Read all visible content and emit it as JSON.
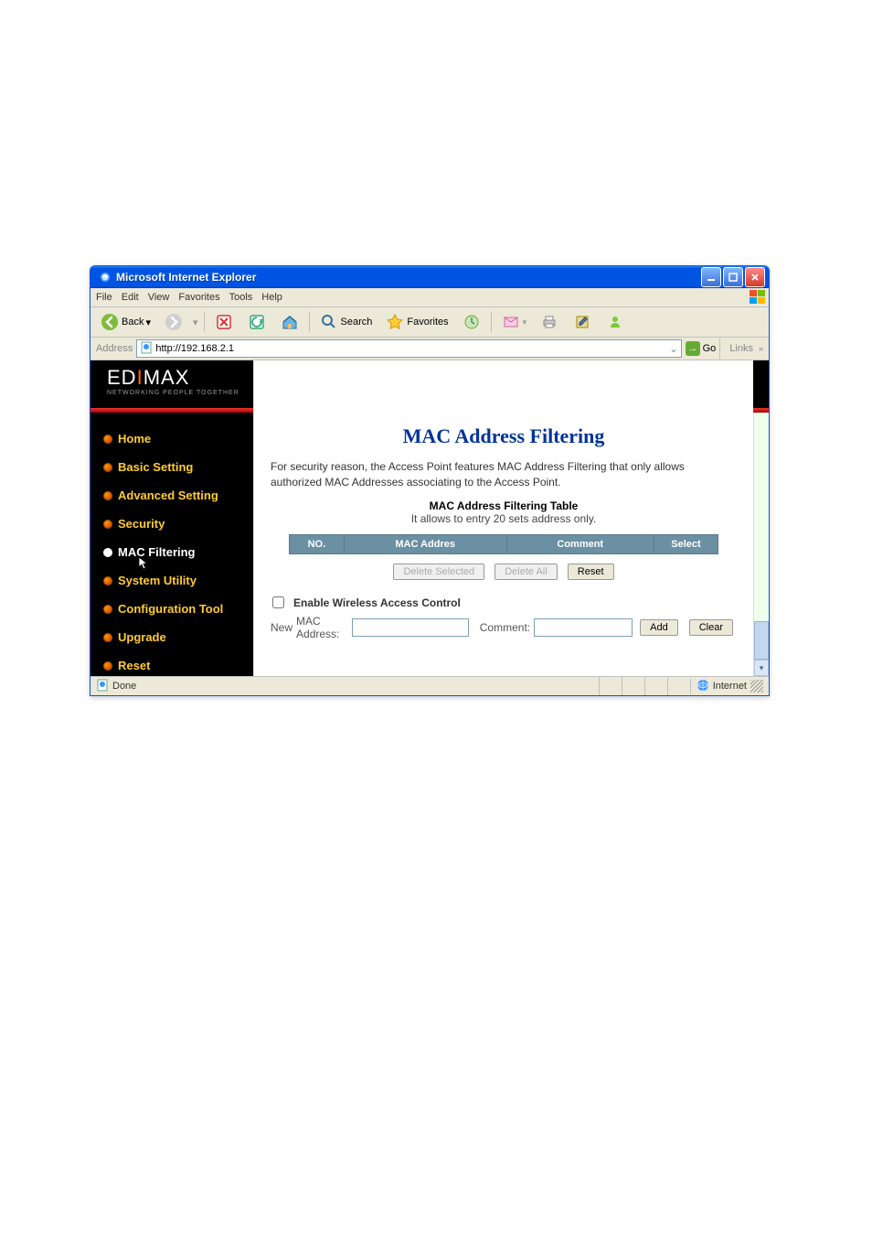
{
  "window": {
    "title": "Microsoft Internet Explorer"
  },
  "menu": {
    "file": "File",
    "edit": "Edit",
    "view": "View",
    "favorites": "Favorites",
    "tools": "Tools",
    "help": "Help"
  },
  "toolbar": {
    "back": "Back",
    "search": "Search",
    "favorites": "Favorites"
  },
  "address": {
    "label": "Address",
    "url": "http://192.168.2.1",
    "go": "Go",
    "links": "Links"
  },
  "brand": {
    "name": "EDIMAX",
    "tagline": "NETWORKING PEOPLE TOGETHER"
  },
  "nav": {
    "items": [
      {
        "label": "Home"
      },
      {
        "label": "Basic Setting"
      },
      {
        "label": "Advanced Setting"
      },
      {
        "label": "Security"
      },
      {
        "label": "MAC Filtering"
      },
      {
        "label": "System Utility"
      },
      {
        "label": "Configuration Tool"
      },
      {
        "label": "Upgrade"
      },
      {
        "label": "Reset"
      }
    ]
  },
  "main": {
    "heading": "MAC Address Filtering",
    "description": "For security reason, the Access Point features MAC Address Filtering that only allows authorized MAC Addresses associating to the Access Point.",
    "table_title": "MAC Address Filtering Table",
    "table_note": "It allows to entry 20 sets address only.",
    "columns": {
      "no": "NO.",
      "mac": "MAC Addres",
      "comment": "Comment",
      "select": "Select"
    },
    "buttons": {
      "delete_selected": "Delete Selected",
      "delete_all": "Delete All",
      "reset": "Reset"
    },
    "acl_label": "Enable Wireless Access Control",
    "new": {
      "row_label": "New",
      "mac_label": "MAC Address:",
      "comment_label": "Comment:",
      "add": "Add",
      "clear": "Clear"
    }
  },
  "status": {
    "done": "Done",
    "zone": "Internet"
  }
}
